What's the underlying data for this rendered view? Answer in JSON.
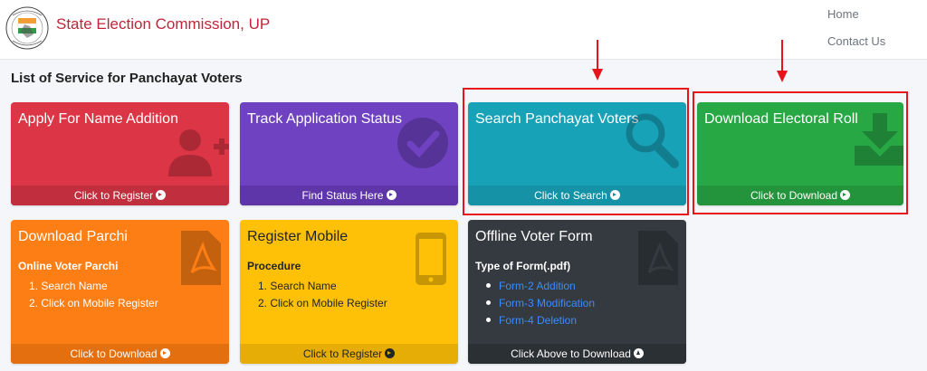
{
  "header": {
    "brand": "State Election Commission, UP",
    "nav": [
      "Home",
      "Contact Us"
    ]
  },
  "page_title": "List of Service for Panchayat Voters",
  "cards": [
    {
      "title": "Apply For Name Addition",
      "footer": "Click to Register",
      "color": "#dc3545",
      "icon": "add-user-icon"
    },
    {
      "title": "Track Application Status",
      "footer": "Find Status Here",
      "color": "#6f42c1",
      "icon": "check-circle-icon"
    },
    {
      "title": "Search Panchayat Voters",
      "footer": "Click to Search",
      "color": "#17a2b8",
      "icon": "search-icon"
    },
    {
      "title": "Download Electoral Roll",
      "footer": "Click to Download",
      "color": "#28a745",
      "icon": "download-icon"
    },
    {
      "title": "Download Parchi",
      "subheading": "Online Voter Parchi",
      "steps": [
        "1. Search Name",
        "2. Click on Mobile Register"
      ],
      "footer": "Click to Download",
      "color": "#fd7e14",
      "icon": "pdf-file-icon"
    },
    {
      "title": "Register Mobile",
      "subheading": "Procedure",
      "steps": [
        "1. Search Name",
        "2. Click on Mobile Register"
      ],
      "footer": "Click to Register",
      "color": "#ffc107",
      "icon": "mobile-phone-icon"
    },
    {
      "title": "Offline Voter Form",
      "subheading": "Type of Form(.pdf)",
      "links": [
        "Form-2 Addition",
        "Form-3 Modification",
        "Form-4 Deletion"
      ],
      "footer": "Click Above to Download",
      "color": "#343a40",
      "icon": "pdf-file-icon"
    }
  ],
  "annotation_color": "#e8141c"
}
